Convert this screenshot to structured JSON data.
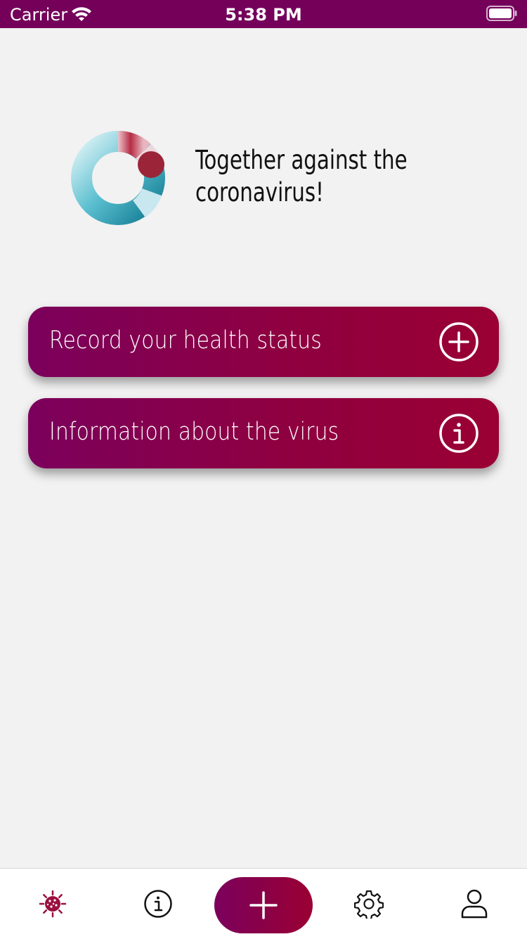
{
  "status_bar": {
    "carrier": "Carrier",
    "time": "5:38 PM",
    "background": "#74005a"
  },
  "hero": {
    "title": "Together against the coronavirus!"
  },
  "actions": [
    {
      "label": "Record your health status",
      "icon": "plus-circle-icon"
    },
    {
      "label": "Information about the virus",
      "icon": "info-circle-icon"
    }
  ],
  "tab_bar": {
    "tabs": [
      {
        "name": "covid",
        "icon": "virus-icon",
        "selected": true
      },
      {
        "name": "information",
        "icon": "info-icon"
      },
      {
        "name": "add",
        "icon": "plus-icon"
      },
      {
        "name": "settings",
        "icon": "gear-icon"
      },
      {
        "name": "profile",
        "icon": "person-icon"
      }
    ]
  },
  "colors": {
    "accent_start": "#7b005c",
    "accent_end": "#9a0033",
    "background": "#f2f2f2"
  }
}
